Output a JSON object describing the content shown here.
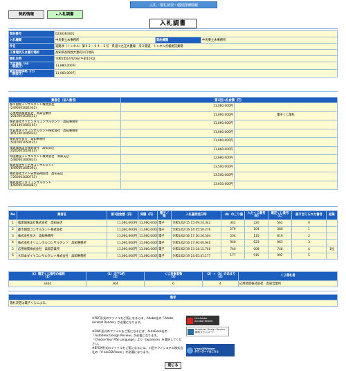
{
  "header": {
    "title": "入札・落札状況・個別詳細情報"
  },
  "tabs": [
    {
      "label": "契約情報"
    },
    {
      "label": "入札調書"
    }
  ],
  "page_title": "入札調書",
  "info": [
    {
      "label": "契約番号",
      "value": "0230383301"
    },
    {
      "label": "入札機関",
      "value": "中央東土木事務所",
      "label2": "契約機関",
      "value2": "中央東土木事務所"
    },
    {
      "label": "件名",
      "value": "道路改（トンネル）第９２－０４－２号　県道川之江大豊線　舟３隧道　トンネル点検委託業務"
    },
    {
      "label": "工事場所又は履行場所",
      "value": "高知県長岡郡大豊町川口地内"
    },
    {
      "label": "開札日時",
      "value": "令和5年02月20日 午前10:02"
    },
    {
      "label": "予定価格（円）\n（税抜き）",
      "value": "13,880,000円"
    },
    {
      "label": "最低制限価格（円）\n（税抜き）",
      "value": "11,060,000円"
    }
  ],
  "bidders_header": {
    "name": "業者名（法人番号）",
    "amount": "第1回入札金額（円）"
  },
  "bidders": [
    {
      "name": "都市開発コンサルタント株式会社",
      "num": "(2490001001632)",
      "amount": "11,060,000円",
      "note": ""
    },
    {
      "name": "応用地質株式会社　高知営業所",
      "num": "(2010001034531)",
      "amount": "11,060,000円",
      "note": "電子くじ落札"
    },
    {
      "name": "株式会社オリエンタルコンサルタンツ　高知事務所",
      "num": "(4011001005165)",
      "amount": "11,060,000円",
      "note": ""
    },
    {
      "name": "大日本ダイヤコンサルタント株式会社　高知事務所",
      "num": "(8013301006930)",
      "amount": "11,060,000円",
      "note": ""
    },
    {
      "name": "株式会社長大　高知事務所",
      "num": "(5010001050435)",
      "amount": "11,060,000円",
      "note": ""
    },
    {
      "name": "復建調査設計株式会社　高知支店",
      "num": "(4240001019433)",
      "amount": "11,060,000円",
      "note": ""
    },
    {
      "name": "四国建設コンサルタント株式会社　高知支店",
      "num": "(5480001000814)",
      "amount": "12,680,000円",
      "note": ""
    },
    {
      "name": "株式会社サン土木コンサルタント",
      "num": "(6490001001091)",
      "amount": "13,500,000円",
      "note": ""
    },
    {
      "name": "株式会社エイト日本技術開発　高知支店",
      "num": "(7260001000735)",
      "amount": "13,500,000円",
      "note": ""
    },
    {
      "name": "株式会社ワタリコンサルタント",
      "num": "(6490001004887)",
      "amount": "13,650,000円",
      "note": ""
    }
  ],
  "lottery_header": [
    "No",
    "業者名",
    "第1回金額（円）",
    "同額（円）",
    "電子／紙",
    "入札書受信日時",
    "（A）のこり値",
    "入力くじ番号\n（B）",
    "確定くじ番号\n（C）",
    "振り当てられた番号",
    "結果"
  ],
  "lottery": [
    [
      "1",
      "復建調査設計株式会社　高知支店",
      "11,060,000円",
      "11,060,000円",
      "電子",
      "令和5/02/15 15:09:24.342",
      "342",
      "220",
      "562",
      "0",
      ""
    ],
    [
      "2",
      "都市開発コンサルタント株式会社",
      "11,060,000円",
      "11,060,000円",
      "電子",
      "令和5/02/16 14:45:50.276",
      "276",
      "104",
      "380",
      "1",
      ""
    ],
    [
      "3",
      "株式会社長大　高知事務所",
      "11,060,000円",
      "11,060,000円",
      "電子",
      "令和5/02/16 17:16:26.504",
      "504",
      "115",
      "619",
      "2",
      ""
    ],
    [
      "4",
      "株式会社オリエンタルコンサルタンツ　高知事務所",
      "11,060,000円",
      "11,060,000円",
      "電子",
      "令和5/02/16 17:40:00.940",
      "940",
      "023",
      "963",
      "3",
      ""
    ],
    [
      "5",
      "応用地質株式会社　高知営業所",
      "11,060,000円",
      "11,060,000円",
      "電子",
      "令和5/02/19 13:14:15.740",
      "740",
      "008",
      "748",
      "4",
      "1位"
    ],
    [
      "6",
      "大日本ダイヤコンサルタント株式会社　高知事務所",
      "11,060,000円",
      "11,060,000円",
      "電子",
      "令和5/02/19 14:05:41.177",
      "177",
      "915",
      "092",
      "5",
      ""
    ]
  ],
  "calc_header": [
    "（C）確定くじ番号の総和\n（1）",
    "（1）の下3桁\n（2）",
    "くじ対象者数\n（3）",
    "（2）÷（3）のあまり\n（4）",
    "くじ落札者"
  ],
  "calc_values": [
    "3364",
    "364",
    "6",
    "4",
    "応用地質株式会社　高知営業所"
  ],
  "remarks": {
    "label": "備考",
    "text": "落札決定は電子くじによる。"
  },
  "notes": [
    "※PDF形式のファイルをご覧になるには、Adobe社の「Adobe Acrobat Reader」が必要になります。",
    "※DWF形式のファイルをご覧になるには、AutoDesk社の「Autodesk Design Review」が必要になります。\n「Choose Your MSI Language」より「Japanese」を選択してください。",
    "※BFOX形式のファイルをご覧になるには、川田テクノシステム株式会社の「V-nas3DViewer」が必要になります。"
  ],
  "badges": [
    {
      "label": "Get Adobe\nAcrobat Reader"
    },
    {
      "label": "Autodesk Design Review\n無料ダウンロード"
    },
    {
      "label": "V-nas3DViewer\nダウンロードはこちら"
    }
  ],
  "close_label": "閉じる",
  "colors": {
    "header_blue": "#1d5fbe",
    "value_yellow": "#fffbd1",
    "tab_green": "#c6f8c2"
  }
}
